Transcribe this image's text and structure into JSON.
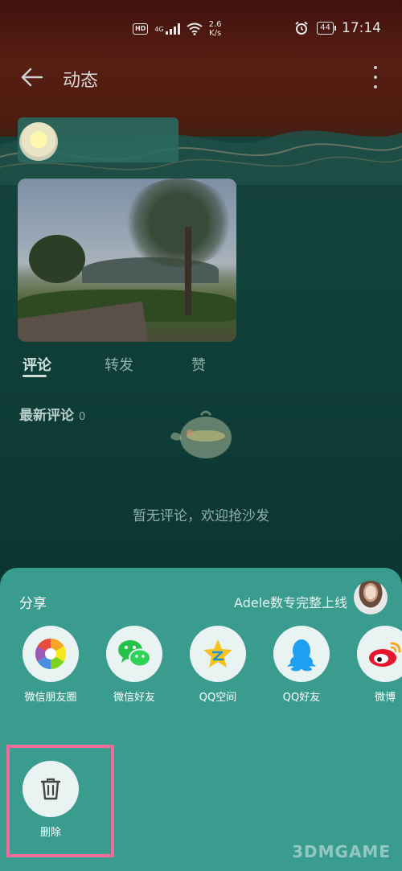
{
  "status_bar": {
    "hd_badge": "HD",
    "network": "4G",
    "speed_value": "2.6",
    "speed_unit": "K/s",
    "battery": "44",
    "time": "17:14"
  },
  "header": {
    "back_icon": "back-arrow-icon",
    "title": "动态",
    "more_icon": "more-vertical-icon"
  },
  "post": {
    "comment_tabs": [
      {
        "label": "评论",
        "active": true
      },
      {
        "label": "转发",
        "active": false
      },
      {
        "label": "赞",
        "active": false
      }
    ],
    "latest_comments_label": "最新评论",
    "latest_comments_count": "0",
    "empty_state_text": "暂无评论，欢迎抢沙发"
  },
  "share_sheet": {
    "title": "分享",
    "user_label": "Adele数专完整上线",
    "options": [
      {
        "label": "微信朋友圈",
        "icon": "wechat-moments-icon"
      },
      {
        "label": "微信好友",
        "icon": "wechat-icon"
      },
      {
        "label": "QQ空间",
        "icon": "qzone-icon"
      },
      {
        "label": "QQ好友",
        "icon": "qq-icon"
      },
      {
        "label": "微博",
        "icon": "weibo-icon"
      }
    ],
    "delete": {
      "label": "删除",
      "icon": "trash-icon"
    }
  },
  "watermark": "3DMGAME",
  "colors": {
    "sheet_bg": "#3a9c8f",
    "highlight_border": "#f06a9a",
    "icon_circle_bg": "#e9f3f1"
  }
}
